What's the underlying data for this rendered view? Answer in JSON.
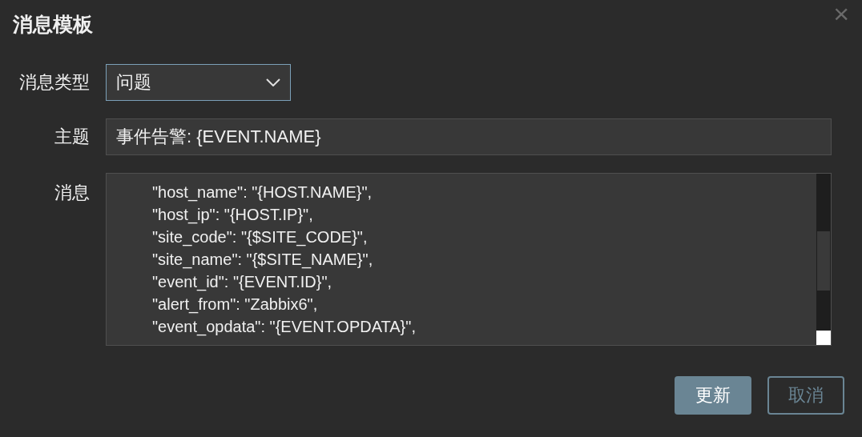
{
  "dialog": {
    "title": "消息模板",
    "close": "×"
  },
  "fields": [
    {
      "kind": "select",
      "label": "消息类型",
      "value": "问题"
    },
    {
      "kind": "text",
      "label": "主题",
      "value": "事件告警: {EVENT.NAME}"
    },
    {
      "kind": "textarea",
      "label": "消息",
      "lines": [
        "\"host_name\": \"{HOST.NAME}\",",
        "\"host_ip\": \"{HOST.IP}\",",
        "\"site_code\": \"{$SITE_CODE}\",",
        "\"site_name\": \"{$SITE_NAME}\",",
        "\"event_id\": \"{EVENT.ID}\",",
        "\"alert_from\": \"Zabbix6\",",
        "\"event_opdata\": \"{EVENT.OPDATA}\","
      ]
    }
  ],
  "buttons": [
    {
      "label": "更新",
      "kind": "primary"
    },
    {
      "label": "取消",
      "kind": "secondary"
    }
  ]
}
